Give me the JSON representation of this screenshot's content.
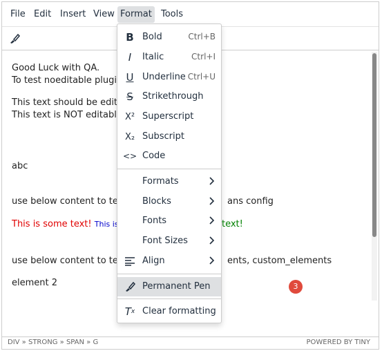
{
  "menubar": {
    "items": [
      {
        "label": "File"
      },
      {
        "label": "Edit"
      },
      {
        "label": "Insert"
      },
      {
        "label": "View"
      },
      {
        "label": "Format"
      },
      {
        "label": "Tools"
      }
    ]
  },
  "toolbar": {
    "permanent_pen_icon": "permanent-pen-icon"
  },
  "content": {
    "line1": "Good Luck with QA.",
    "line2": "To test noeditable plugi",
    "line3": "This text should be edita",
    "line4": "This text is NOT editabl",
    "line5": "abc",
    "line6a": "use below content to tes",
    "line6b": "ans config",
    "line7_red": "This is some text!",
    "line7_blue": "This is",
    "line7_green": "text!",
    "line8a": "use below content to tes",
    "line8b": "ents, custom_elements",
    "line9": "element 2",
    "badge": "3"
  },
  "format_menu": {
    "items": [
      {
        "label": "Bold",
        "shortcut": "Ctrl+B",
        "icon": "B"
      },
      {
        "label": "Italic",
        "shortcut": "Ctrl+I",
        "icon": "I"
      },
      {
        "label": "Underline",
        "shortcut": "Ctrl+U",
        "icon": "U"
      },
      {
        "label": "Strikethrough",
        "icon": "S"
      },
      {
        "label": "Superscript",
        "icon": "X²"
      },
      {
        "label": "Subscript",
        "icon": "X₂"
      },
      {
        "label": "Code",
        "icon": "<>"
      },
      {
        "label": "Formats"
      },
      {
        "label": "Blocks"
      },
      {
        "label": "Fonts"
      },
      {
        "label": "Font Sizes"
      },
      {
        "label": "Align"
      },
      {
        "label": "Permanent Pen"
      },
      {
        "label": "Clear formatting"
      }
    ]
  },
  "statusbar": {
    "path": "DIV » STRONG » SPAN » G",
    "brand": "POWERED BY TINY"
  },
  "colors": {
    "red": "#e00000",
    "blue": "#0000cc",
    "green": "#008000",
    "highlight": "#dee0e2",
    "badge": "#e04a3c"
  }
}
